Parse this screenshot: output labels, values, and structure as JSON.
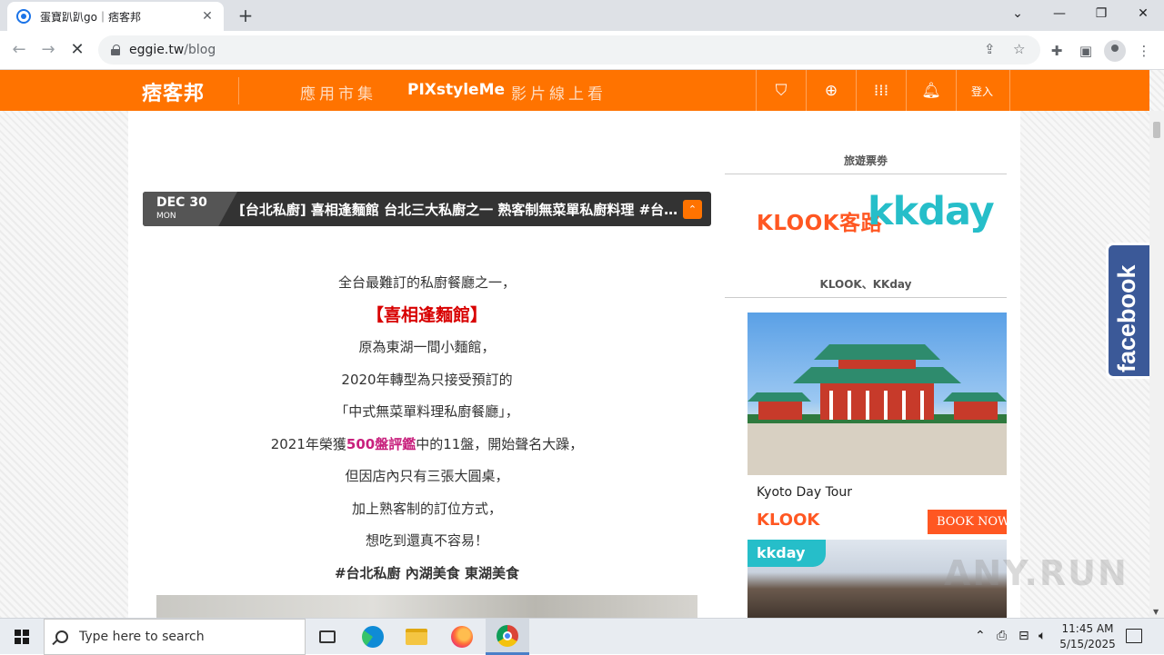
{
  "browser": {
    "tab_title": "蛋寶趴趴go｜痞客邦",
    "new_tab_symbol": "+",
    "tab_close_symbol": "✕",
    "url_host": "eggie.tw",
    "url_path": "/blog",
    "window_controls": [
      "chevron-down",
      "minimize",
      "restore",
      "close"
    ]
  },
  "site_header": {
    "logo": "痞客邦",
    "nav": [
      "應用市集",
      "PIXstyleMe",
      "影片線上看"
    ],
    "login_label": "登入",
    "accent_color": "#ff7300",
    "icons": [
      "bookmark-icon",
      "zoom-icon",
      "apps-grid-icon",
      "bell-icon"
    ]
  },
  "post": {
    "date_month_day": "DEC 30",
    "date_weekday": "MON",
    "title": "[台北私廚] 喜相逢麵館 台北三大私廚之一 熟客制無菜單私廚料理 #台北私廚 內湖美食 東湖美食",
    "top_button_symbol": "⌃",
    "lines": {
      "l1": "全台最難訂的私廚餐廳之一，",
      "l2": "【喜相逢麵館】",
      "l3": "原為東湖一間小麵館，",
      "l4": "2020年轉型為只接受預訂的",
      "l5": "「中式無菜單料理私廚餐廳」，",
      "l6_a": "2021年榮獲",
      "l6_b": "500盤評鑑",
      "l6_c": "中的11盤，開始聲名大躁，",
      "l7": "但因店內只有三張大圓桌，",
      "l8": "加上熟客制的訂位方式，",
      "l9": "想吃到還真不容易！",
      "l10": "#台北私廚 內湖美食 東湖美食"
    }
  },
  "sidebar": {
    "section1_title": "旅遊票劵",
    "klook_text": "KLOOK客路",
    "kkday_text": "kkday",
    "section2_title": "KLOOK、KKday",
    "ad": {
      "tour_name": "Kyoto Day Tour",
      "brand": "KLOOK",
      "book_label": "BOOK NOW",
      "kkday_badge": "kkday"
    }
  },
  "facebook_tab": "facebook",
  "watermark": "ANY.RUN",
  "taskbar": {
    "search_placeholder": "Type here to search",
    "time": "11:45 AM",
    "date": "5/15/2025"
  }
}
